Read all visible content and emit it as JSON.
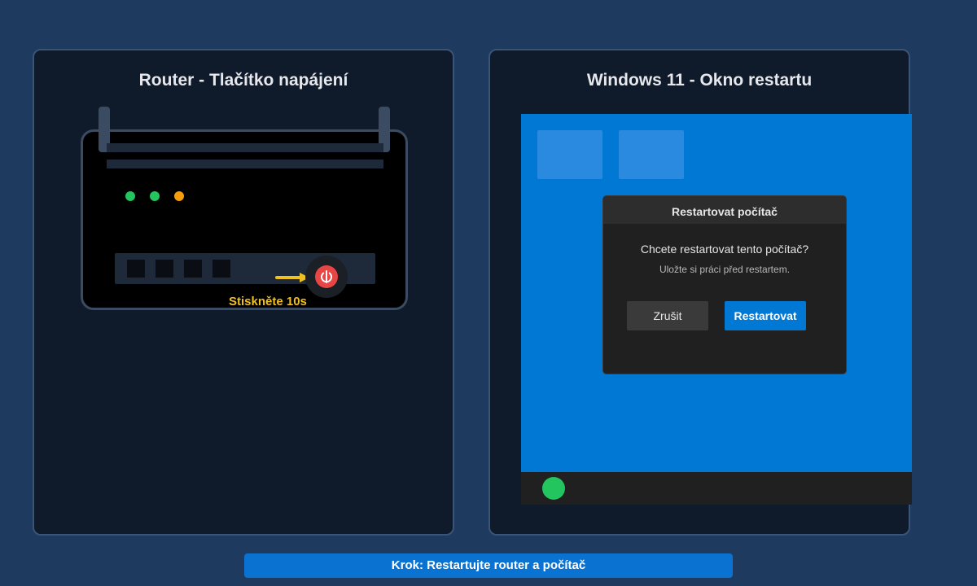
{
  "router_panel": {
    "title": "Router - Tlačítko napájení",
    "press_label": "Stiskněte 10s",
    "led_colors": [
      "#22c55e",
      "#22c55e",
      "#f59e0b"
    ],
    "power_button_color": "#e84545",
    "arrow_color": "#f0c020"
  },
  "windows_panel": {
    "title": "Windows 11 - Okno restartu",
    "desktop_color": "#0078d4",
    "dialog": {
      "title": "Restartovat počítač",
      "message": "Chcete restartovat tento počítač?",
      "sub_message": "Uložte si práci před restartem.",
      "cancel_label": "Zrušit",
      "confirm_label": "Restartovat"
    }
  },
  "step": {
    "label": "Krok: Restartujte router a počítač"
  }
}
